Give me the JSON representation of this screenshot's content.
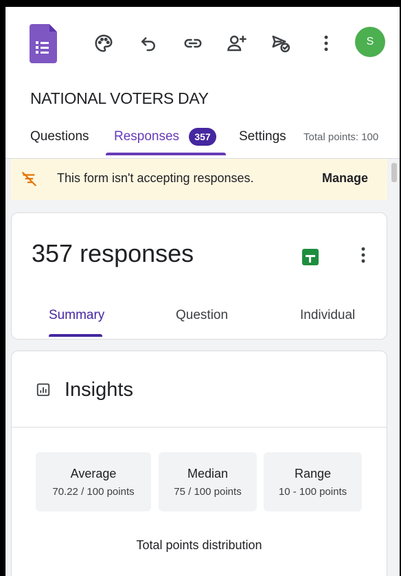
{
  "form": {
    "title": "NATIONAL VOTERS DAY"
  },
  "user": {
    "avatar_letter": "S"
  },
  "toolbar": {
    "icons": [
      "palette-icon",
      "undo-icon",
      "link-icon",
      "add-collaborator-icon",
      "send-icon",
      "more-vert-icon"
    ]
  },
  "tabs": {
    "questions": "Questions",
    "responses": "Responses",
    "responses_badge": "357",
    "settings": "Settings",
    "total_points": "Total points: 100"
  },
  "banner": {
    "text": "This form isn't accepting responses.",
    "action": "Manage"
  },
  "responses_card": {
    "count_label": "357 responses",
    "subtabs": {
      "summary": "Summary",
      "question": "Question",
      "individual": "Individual"
    }
  },
  "insights": {
    "title": "Insights",
    "stats": [
      {
        "label": "Average",
        "value": "70.22 / 100 points"
      },
      {
        "label": "Median",
        "value": "75 / 100 points"
      },
      {
        "label": "Range",
        "value": "10 - 100 points"
      }
    ],
    "distribution_title": "Total points distribution"
  },
  "colors": {
    "accent": "#673ab7",
    "badge": "#4527a0",
    "banner_bg": "#fef7e0",
    "sheets_green": "#1e8e3e",
    "avatar_green": "#4caf50"
  }
}
